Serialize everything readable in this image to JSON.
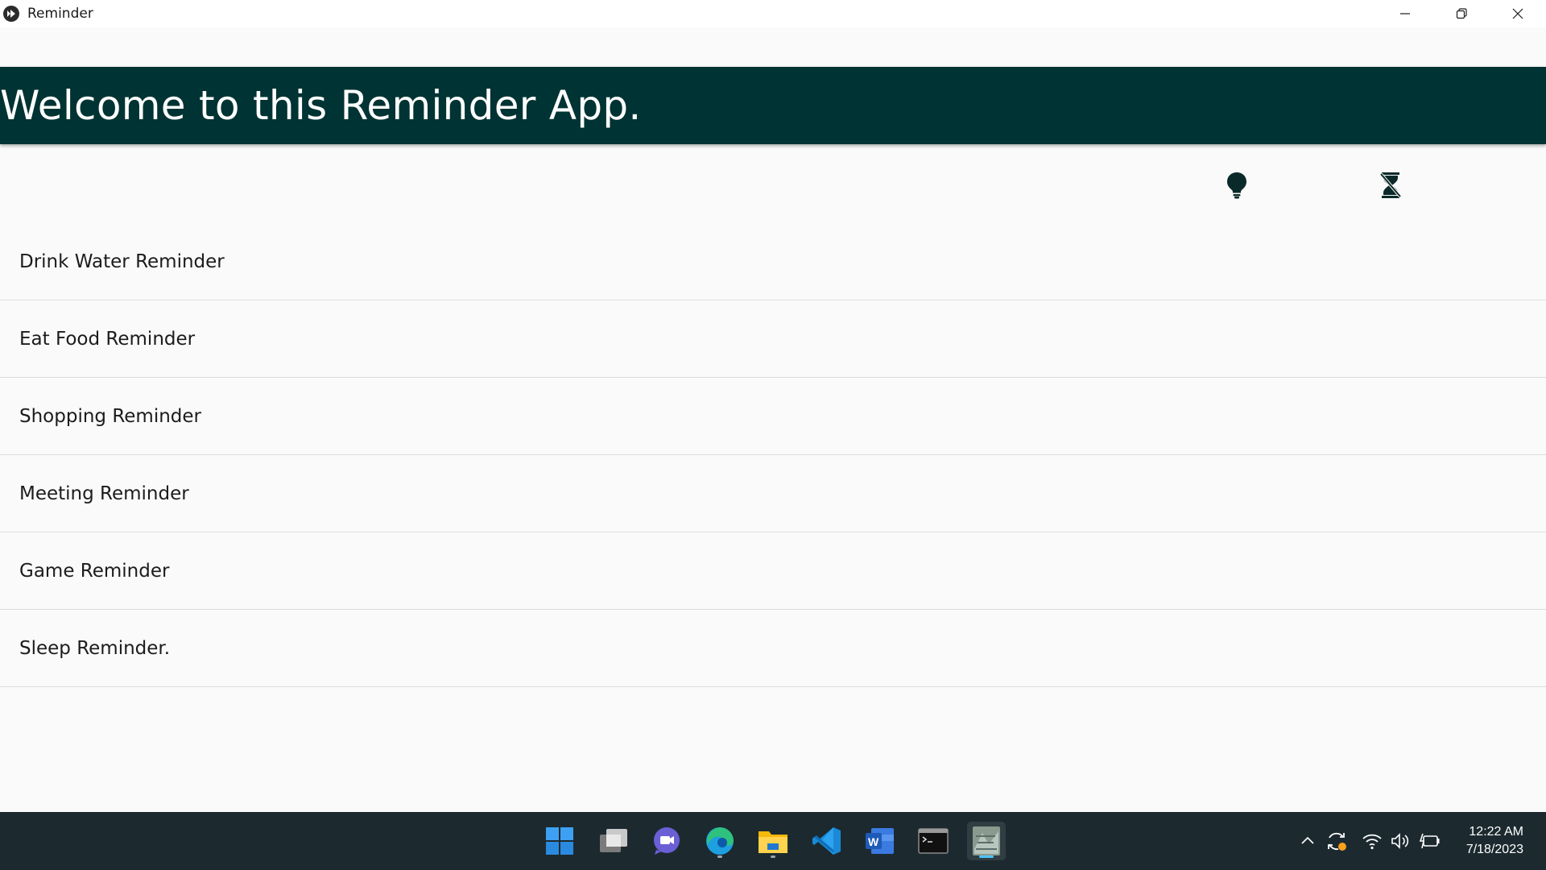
{
  "window": {
    "title": "Reminder",
    "app_icon": "kivy-app-icon",
    "controls": [
      "minimize-icon",
      "restore-icon",
      "close-icon"
    ]
  },
  "header": {
    "title": "Welcome to this Reminder App.",
    "background": "#003333"
  },
  "toolbar": {
    "icons": [
      "lightbulb-icon",
      "timer-off-icon"
    ]
  },
  "reminders": [
    {
      "label": "Drink Water Reminder"
    },
    {
      "label": "Eat Food Reminder"
    },
    {
      "label": "Shopping Reminder"
    },
    {
      "label": "Meeting Reminder"
    },
    {
      "label": "Game Reminder"
    },
    {
      "label": "Sleep Reminder."
    }
  ],
  "taskbar": {
    "apps": [
      "windows-start-icon",
      "task-view-icon",
      "teams-chat-icon",
      "edge-icon",
      "file-explorer-icon",
      "vscode-icon",
      "word-icon",
      "terminal-icon",
      "reminder-app-icon"
    ],
    "tray": [
      "chevron-up-icon",
      "sync-icon",
      "wifi-icon",
      "volume-icon",
      "battery-icon"
    ],
    "time": "12:22 AM",
    "date": "7/18/2023"
  }
}
